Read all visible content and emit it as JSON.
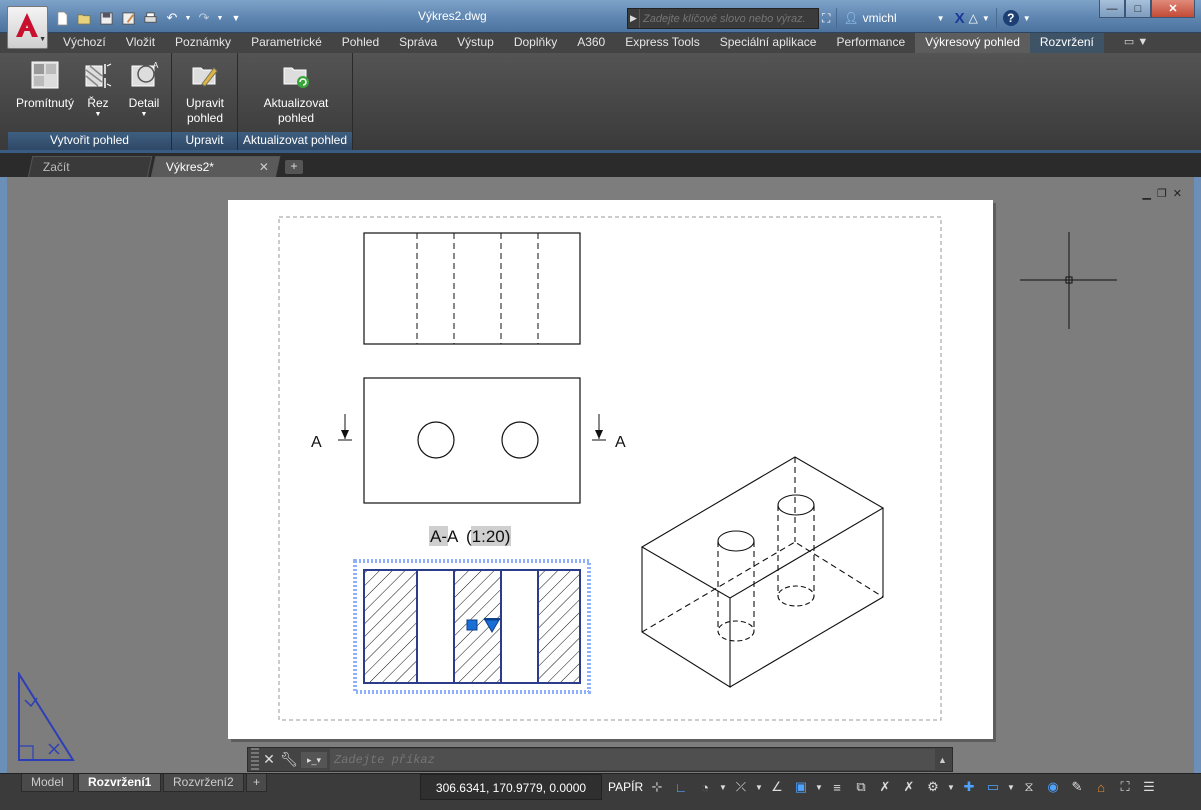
{
  "window": {
    "title": "Výkres2.dwg",
    "minimize": "—",
    "maximize": "□",
    "close": "✕"
  },
  "search": {
    "placeholder": "Zadejte klíčové slovo nebo výraz."
  },
  "user": {
    "name": "vmichl"
  },
  "ribbon_tabs": [
    {
      "label": "Výchozí"
    },
    {
      "label": "Vložit"
    },
    {
      "label": "Poznámky"
    },
    {
      "label": "Parametrické"
    },
    {
      "label": "Pohled"
    },
    {
      "label": "Správa"
    },
    {
      "label": "Výstup"
    },
    {
      "label": "Doplňky"
    },
    {
      "label": "A360"
    },
    {
      "label": "Express Tools"
    },
    {
      "label": "Speciální aplikace"
    },
    {
      "label": "Performance"
    },
    {
      "label": "Výkresový pohled"
    },
    {
      "label": "Rozvržení"
    }
  ],
  "ribbon": {
    "panels": [
      {
        "title": "Vytvořit pohled",
        "buttons": [
          "Promítnutý",
          "Řez",
          "Detail"
        ]
      },
      {
        "title": "Upravit",
        "buttons": [
          "Upravit\npohled"
        ]
      },
      {
        "title": "Aktualizovat pohled",
        "buttons": [
          "Aktualizovat\npohled"
        ]
      }
    ],
    "b_promitnuty": "Promítnutý",
    "b_rez": "Řez",
    "b_detail": "Detail",
    "b_upravit_1": "Upravit",
    "b_upravit_2": "pohled",
    "b_aktual_1": "Aktualizovat",
    "b_aktual_2": "pohled"
  },
  "file_tabs": [
    {
      "label": "Začít"
    },
    {
      "label": "Výkres2*"
    }
  ],
  "drawing": {
    "section_label_left": "A",
    "section_label_right": "A",
    "section_title": "A-A",
    "section_scale": "(1:20)"
  },
  "command": {
    "placeholder": "Zadejte příkaz"
  },
  "layout_tabs": [
    {
      "label": "Model"
    },
    {
      "label": "Rozvržení1"
    },
    {
      "label": "Rozvržení2"
    }
  ],
  "status": {
    "coordinates": "306.6341, 170.9779, 0.0000",
    "space": "PAPÍR"
  },
  "colors": {
    "titlebar": "#6b8fb6",
    "accent_blue": "#1a6fd6",
    "selection_blue": "#2a5bd7"
  }
}
